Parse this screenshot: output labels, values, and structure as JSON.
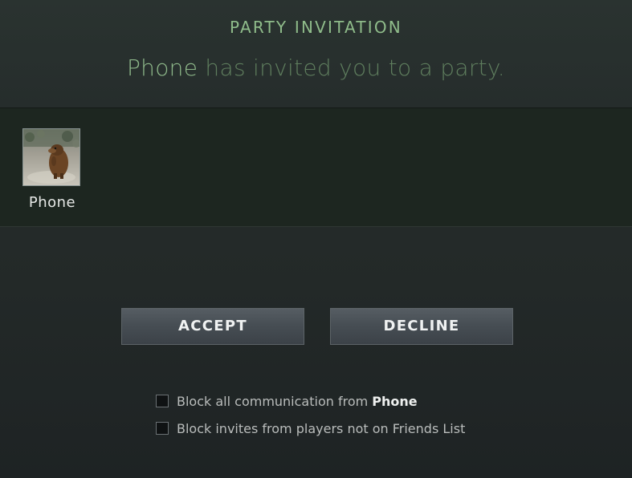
{
  "dialog": {
    "title": "PARTY INVITATION",
    "inviter": "Phone",
    "subtitle_rest": " has invited you to a party."
  },
  "members": [
    {
      "name": "Phone",
      "avatar": "groundhog-avatar"
    }
  ],
  "buttons": {
    "accept": "ACCEPT",
    "decline": "DECLINE"
  },
  "options": [
    {
      "label": "Block all communication from ",
      "highlight": "Phone",
      "checked": false
    },
    {
      "label": "Block invites from players not on Friends List",
      "checked": false
    }
  ],
  "colors": {
    "title": "#8fbc8a",
    "subtitle": "#5f7e5e",
    "inviter": "#8eb88a",
    "members_band": "#1d2620",
    "button": "#474e54"
  }
}
